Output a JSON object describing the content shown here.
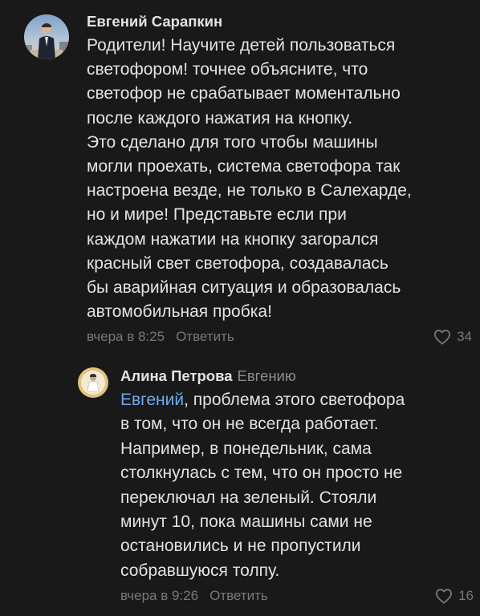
{
  "comments": [
    {
      "author": "Евгений Сарапкин",
      "text": "Родители! Научите детей пользоваться\nсветофором! точнее объясните, что\nсветофор не срабатывает моментально\nпосле каждого нажатия на кнопку.\nЭто сделано для того чтобы машины\nмогли проехать, система светофора так\nнастроена везде, не только в Салехарде,\nно и мире! Представьте если при\nкаждом нажатии на кнопку загорался\nкрасный свет светофора, создавалась\nбы аварийная ситуация и образовалась\nавтомобильная пробка!",
      "time": "вчера в 8:25",
      "reply_label": "Ответить",
      "likes": "34"
    },
    {
      "author": "Алина Петрова",
      "reply_to": "Евгению",
      "mention": "Евгений",
      "text": ", проблема этого светофора\nв том, что он не всегда работает.\nНапример, в понедельник, сама\nстолкнулась с тем, что он просто не\nпереключал на зеленый. Стояли\nминут 10, пока машины сами не\nостановились и не пропустили\nсобравшуюся толпу.",
      "time": "вчера в 9:26",
      "reply_label": "Ответить",
      "likes": "16"
    }
  ],
  "colors": {
    "background": "#19191a",
    "text": "#e1e3e6",
    "secondary": "#76787a",
    "mention": "#71aaeb"
  },
  "icons": {
    "like": "heart-outline-icon"
  }
}
